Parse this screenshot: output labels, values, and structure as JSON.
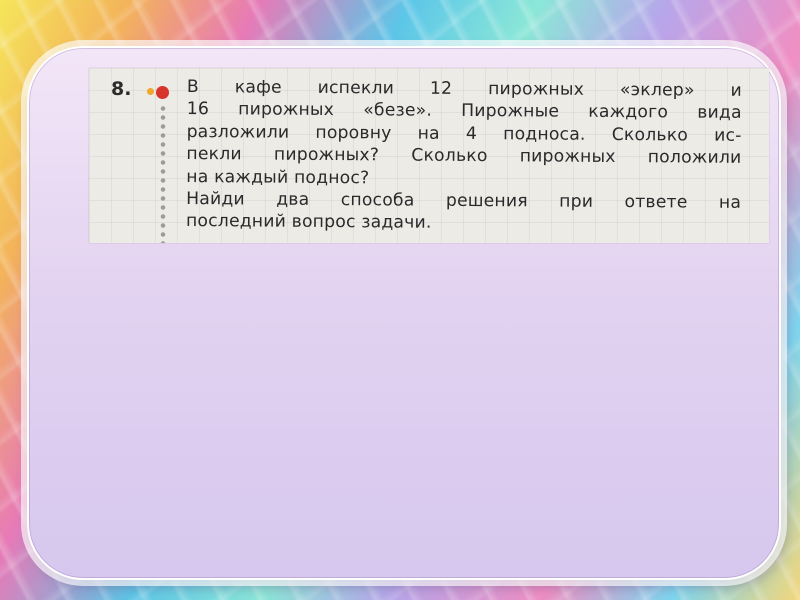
{
  "task": {
    "number": "8.",
    "lines": [
      "В кафе испекли 12 пирожных «эклер» и",
      "16 пирожных «безе». Пирожные каждого вида",
      "разложили поровну на 4 подноса. Сколько ис-",
      "пекли пирожных? Сколько пирожных положили",
      "на каждый поднос?",
      "Найди два способа решения при ответе на",
      "последний вопрос задачи."
    ]
  },
  "colors": {
    "card_background": "#e3d3f1",
    "marker_orange": "#f0a72a",
    "marker_red": "#d8342b"
  }
}
